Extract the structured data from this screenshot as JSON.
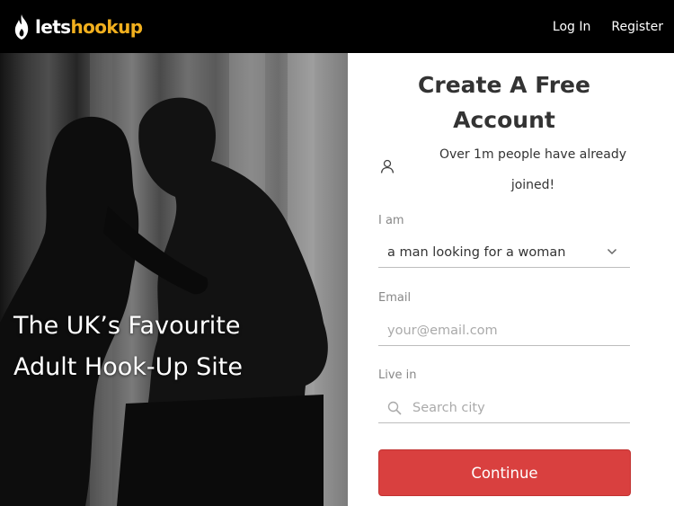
{
  "header": {
    "logo_part1": "lets",
    "logo_part2": "hookup",
    "login_label": "Log In",
    "register_label": "Register"
  },
  "hero": {
    "headline": "The UK’s Favourite\nAdult Hook-Up Site"
  },
  "signup": {
    "title": "Create A Free\nAccount",
    "joined_text": "Over 1m people have already\njoined!",
    "iam_label": "I am",
    "iam_value": "a man looking for a woman",
    "email_label": "Email",
    "email_placeholder": "your@email.com",
    "livein_label": "Live in",
    "city_placeholder": "Search city",
    "continue_label": "Continue"
  },
  "icons": {
    "logo": "flame-icon",
    "user": "user-icon",
    "select": "chevron-down-icon",
    "search": "search-icon"
  },
  "colors": {
    "brand_accent": "#f2b01e",
    "button": "#d9403f",
    "topbar": "#000000"
  }
}
